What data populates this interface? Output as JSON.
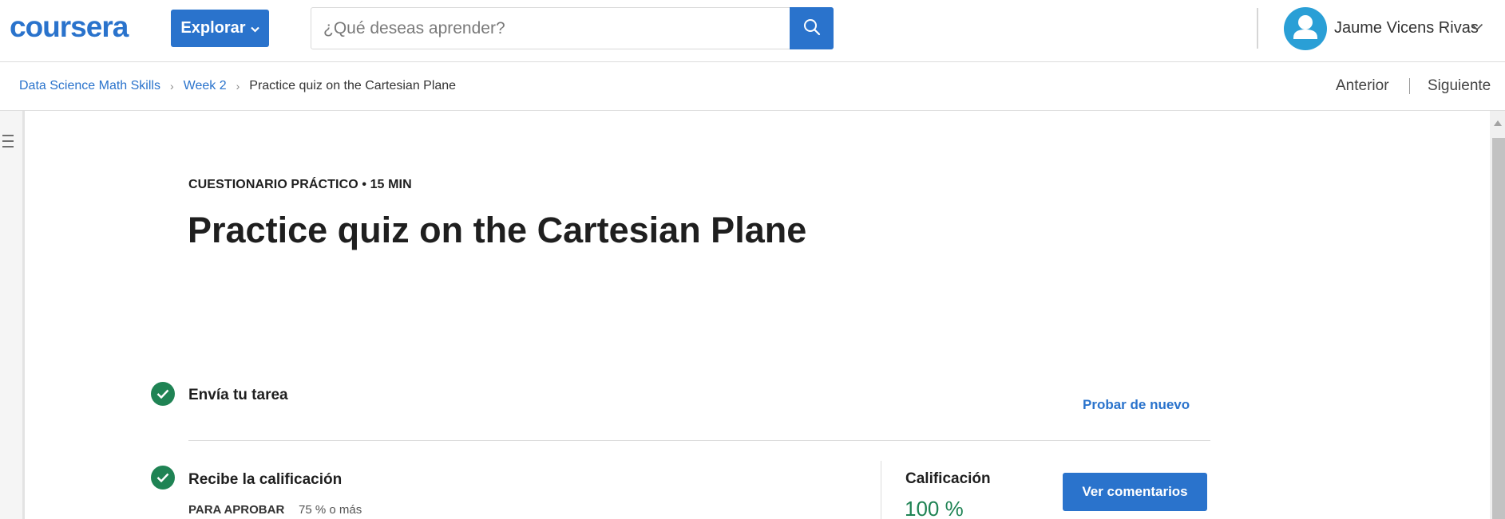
{
  "header": {
    "logo_text": "coursera",
    "explore_label": "Explorar",
    "search_placeholder": "¿Qué deseas aprender?",
    "user_name": "Jaume Vicens Rivas",
    "brand_color": "#2a73cc",
    "avatar_color": "#2a9fd6"
  },
  "breadcrumb": {
    "items": [
      "Data Science Math Skills",
      "Week 2"
    ],
    "current": "Practice quiz on the Cartesian Plane"
  },
  "nav": {
    "prev_label": "Anterior",
    "next_label": "Siguiente"
  },
  "main": {
    "item_type": "CUESTIONARIO PRÁCTICO • 15 MIN",
    "title": "Practice quiz on the Cartesian Plane",
    "steps": [
      {
        "title": "Envía tu tarea",
        "status": "complete",
        "action_label": "Probar de nuevo"
      },
      {
        "title": "Recibe la calificación",
        "status": "complete",
        "pass_label": "PARA APROBAR",
        "pass_value": "75 % o más"
      }
    ],
    "grade": {
      "label": "Calificación",
      "value": "100 %",
      "color": "#1f8354"
    },
    "feedback_label": "Ver comentarios"
  },
  "icons": [
    "search-icon",
    "chevron-down-icon",
    "user-icon",
    "menu-icon",
    "check-icon"
  ]
}
